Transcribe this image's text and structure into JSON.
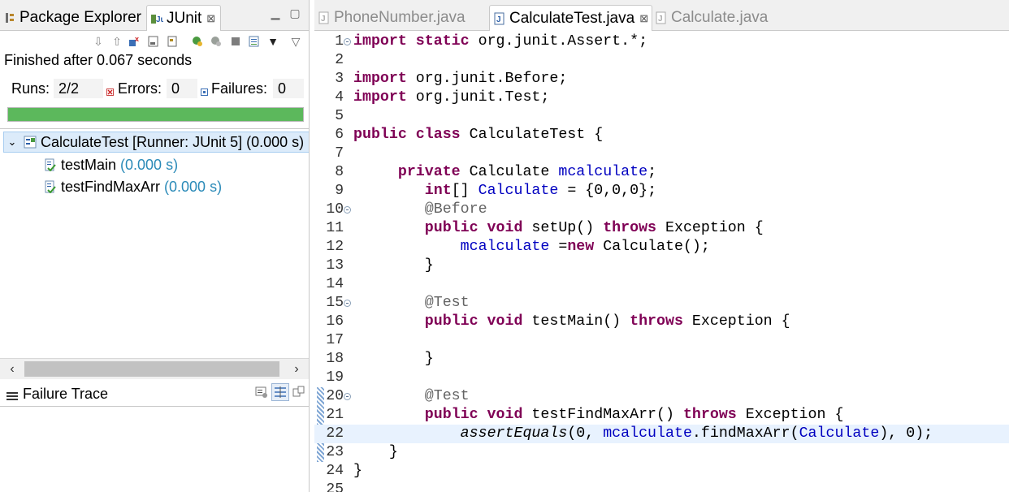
{
  "left_panel": {
    "tabs": [
      {
        "label": "Package Explorer",
        "icon": "package-explorer-icon",
        "active": false
      },
      {
        "label": "JUnit",
        "icon": "junit-icon",
        "active": true
      }
    ],
    "tab_close_glyph": "⊠",
    "status_text": "Finished after 0.067 seconds",
    "counters": {
      "runs_label": "Runs:",
      "runs_value": "2/2",
      "errors_label": "Errors:",
      "errors_value": "0",
      "failures_label": "Failures:",
      "failures_value": "0"
    },
    "progress": 1.0,
    "progress_color": "#5cb85c",
    "tree": {
      "root_label": "CalculateTest [Runner: JUnit 5] (0.000 s)",
      "tests": [
        {
          "name": "testMain",
          "time": "(0.000 s)"
        },
        {
          "name": "testFindMaxArr",
          "time": "(0.000 s)"
        }
      ]
    },
    "failure_trace_title": "Failure Trace"
  },
  "editor": {
    "tabs": [
      {
        "label": "PhoneNumber.java",
        "active": false
      },
      {
        "label": "CalculateTest.java",
        "active": true
      },
      {
        "label": "Calculate.java",
        "active": false
      }
    ],
    "current_line": 22,
    "lines": [
      {
        "n": "1",
        "fold": true
      },
      {
        "n": "2"
      },
      {
        "n": "3"
      },
      {
        "n": "4"
      },
      {
        "n": "5"
      },
      {
        "n": "6"
      },
      {
        "n": "7"
      },
      {
        "n": "8"
      },
      {
        "n": "9"
      },
      {
        "n": "10",
        "fold": true
      },
      {
        "n": "11"
      },
      {
        "n": "12"
      },
      {
        "n": "13"
      },
      {
        "n": "14"
      },
      {
        "n": "15",
        "fold": true
      },
      {
        "n": "16"
      },
      {
        "n": "17"
      },
      {
        "n": "18"
      },
      {
        "n": "19"
      },
      {
        "n": "20",
        "fold": true
      },
      {
        "n": "21"
      },
      {
        "n": "22"
      },
      {
        "n": "23"
      },
      {
        "n": "24"
      },
      {
        "n": "25"
      }
    ],
    "code": {
      "l1": [
        "import static",
        " org.junit.Assert.*;"
      ],
      "l3": [
        "import",
        " org.junit.Before;"
      ],
      "l4": [
        "import",
        " org.junit.Test;"
      ],
      "l6": [
        "public class",
        " CalculateTest {"
      ],
      "l8": [
        "     ",
        "private",
        " Calculate ",
        "mcalculate",
        ";"
      ],
      "l9": [
        "        ",
        "int",
        "[] ",
        "Calculate",
        " = {0,0,0};"
      ],
      "l10": [
        "        ",
        "@Before"
      ],
      "l11": [
        "        ",
        "public void",
        " setUp() ",
        "throws",
        " Exception {"
      ],
      "l12": [
        "            ",
        "mcalculate",
        " =",
        "new",
        " Calculate();"
      ],
      "l13": [
        "        }"
      ],
      "l15": [
        "        ",
        "@Test"
      ],
      "l16": [
        "        ",
        "public void",
        " testMain() ",
        "throws",
        " Exception {"
      ],
      "l18": [
        "        }"
      ],
      "l20": [
        "        ",
        "@Test"
      ],
      "l21": [
        "        ",
        "public void",
        " testFindMaxArr() ",
        "throws",
        " Exception {"
      ],
      "l22": [
        "            ",
        "assertEquals",
        "(0, ",
        "mcalculate",
        ".findMaxArr(",
        "Calculate",
        "), 0);"
      ],
      "l23": [
        "    }"
      ],
      "l24": [
        "}"
      ]
    }
  },
  "colors": {
    "keyword": "#7f0055",
    "field": "#0000c0",
    "annotation": "#646464",
    "time_text": "#2a8ab8",
    "current_line": "#e8f2fe"
  }
}
